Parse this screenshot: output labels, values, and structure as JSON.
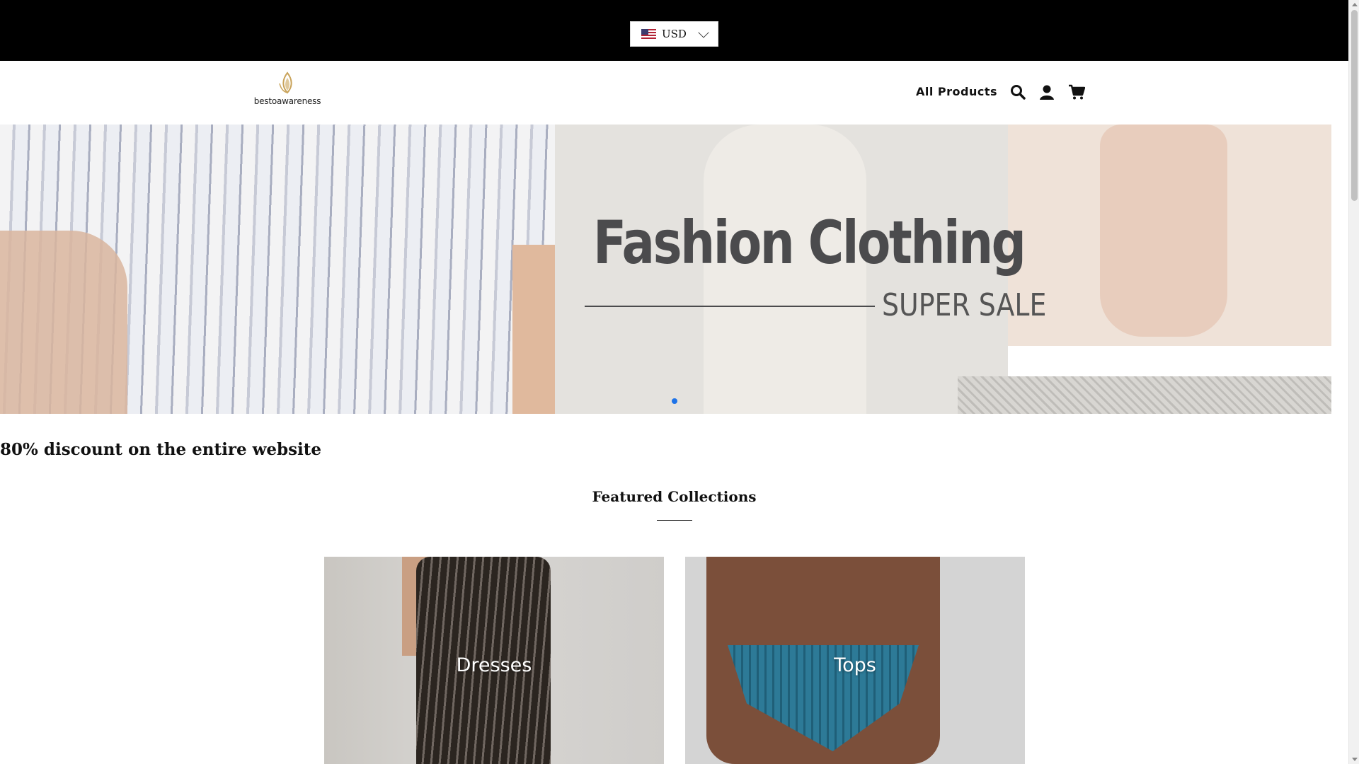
{
  "currency": {
    "code": "USD",
    "flag": "us-flag-icon"
  },
  "header": {
    "logo_text": "bestoawareness",
    "nav_all_products": "All Products",
    "icons": [
      "search-icon",
      "account-icon",
      "cart-icon"
    ]
  },
  "hero": {
    "title": "Fashion Clothing",
    "subtitle": "SUPER SALE",
    "slide_count": 1,
    "active_slide": 1
  },
  "promo_text": "80% discount on the entire website",
  "featured": {
    "title": "Featured Collections",
    "collections": [
      {
        "label": "Dresses"
      },
      {
        "label": "Tops"
      }
    ]
  },
  "colors": {
    "topbar": "#000000",
    "slider_dot": "#1e73e8",
    "logo_accent": "#c9a35a"
  }
}
